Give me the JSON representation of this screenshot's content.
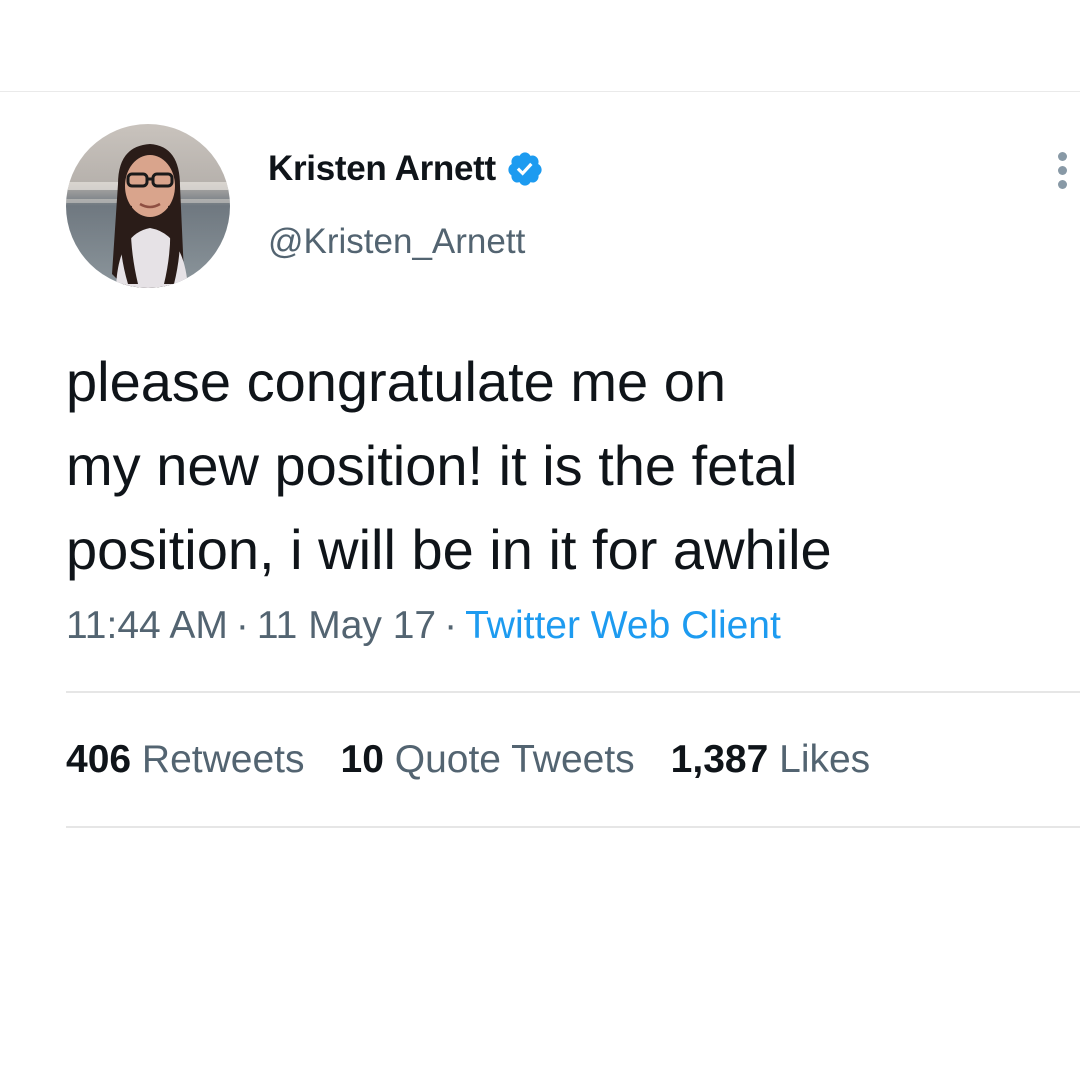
{
  "profile": {
    "display_name": "Kristen Arnett",
    "handle": "@Kristen_Arnett",
    "verified": true,
    "avatar_icon": "profile-photo",
    "verified_icon": "verified-badge-icon",
    "verified_color": "#1d9bf0"
  },
  "tweet": {
    "lines": [
      "please congratulate me on",
      "my new position! it is the fetal",
      "position, i will be in it for awhile"
    ]
  },
  "meta": {
    "time": "11:44 AM",
    "date": "11 May 17",
    "separator": "·",
    "source": "Twitter Web Client"
  },
  "stats": {
    "retweets_count": "406",
    "retweets_label": "Retweets",
    "quotes_count": "10",
    "quotes_label": "Quote Tweets",
    "likes_count": "1,387",
    "likes_label": "Likes"
  },
  "colors": {
    "text": "#0f1419",
    "secondary": "#536471",
    "link": "#1d9bf0",
    "divider": "#e6e6e6"
  }
}
